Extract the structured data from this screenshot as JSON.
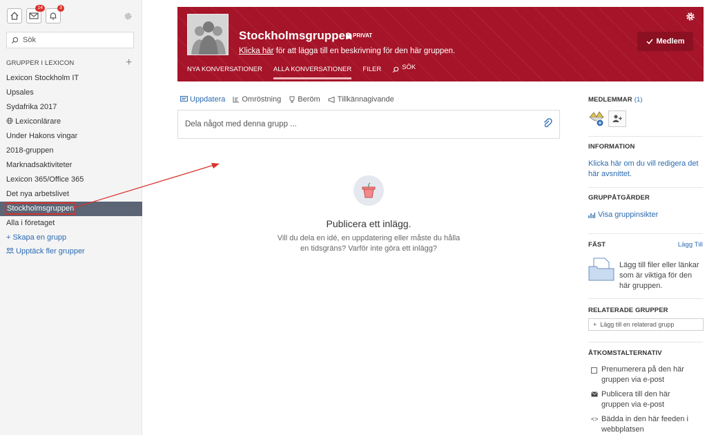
{
  "sidebar": {
    "badges": {
      "mail": "14",
      "bell": "3"
    },
    "search_placeholder": "Sök",
    "groups_header": "GRUPPER I LEXICON",
    "items": [
      {
        "label": "Lexicon Stockholm IT"
      },
      {
        "label": "Upsales"
      },
      {
        "label": "Sydafrika 2017"
      },
      {
        "label": "Lexiconlärare",
        "icon": "globe-icon"
      },
      {
        "label": "Under Hakons vingar"
      },
      {
        "label": "2018-gruppen"
      },
      {
        "label": "Marknadsaktiviteter"
      },
      {
        "label": "Lexicon 365/Office 365"
      },
      {
        "label": "Det nya arbetslivet"
      },
      {
        "label": "Stockholmsgruppen",
        "active": true
      },
      {
        "label": "Alla i företaget"
      }
    ],
    "create_group": "Skapa en grupp",
    "discover_groups": "Upptäck fler grupper"
  },
  "banner": {
    "title": "Stockholmsgruppen",
    "privacy": "PRIVAT",
    "desc_link": "Klicka här",
    "desc_rest": " för att lägga till en beskrivning för den här gruppen.",
    "tabs": [
      "NYA KONVERSATIONER",
      "ALLA KONVERSATIONER",
      "FILER",
      "SÖK"
    ],
    "member_button": "Medlem",
    "color": "#a51428"
  },
  "publisher": {
    "tabs": [
      "Uppdatera",
      "Omröstning",
      "Beröm",
      "Tillkännagivande"
    ],
    "placeholder": "Dela något med denna grupp ..."
  },
  "empty": {
    "title": "Publicera ett inlägg.",
    "text": "Vill du dela en idé, en uppdatering eller måste du hålla en tidsgräns? Varför inte göra ett inlägg?"
  },
  "right": {
    "members_header": "MEDLEMMAR",
    "members_count": "(1)",
    "info_header": "INFORMATION",
    "info_link": "Klicka här om du vill redigera det här avsnittet.",
    "actions_header": "GRUPPÅTGÄRDER",
    "insights_link": "Visa gruppinsikter",
    "pinned_header": "FÄST",
    "pinned_add": "Lägg Till",
    "pinned_text": "Lägg till filer eller länkar som är viktiga för den här gruppen.",
    "related_header": "RELATERADE GRUPPER",
    "related_placeholder": "Lägg till en relaterad grupp",
    "access_header": "ÅTKOMSTALTERNATIV",
    "access_options": [
      "Prenumerera på den här gruppen via e-post",
      "Publicera till den här gruppen via e-post",
      "Bädda in den här feeden i webbplatsen"
    ]
  }
}
